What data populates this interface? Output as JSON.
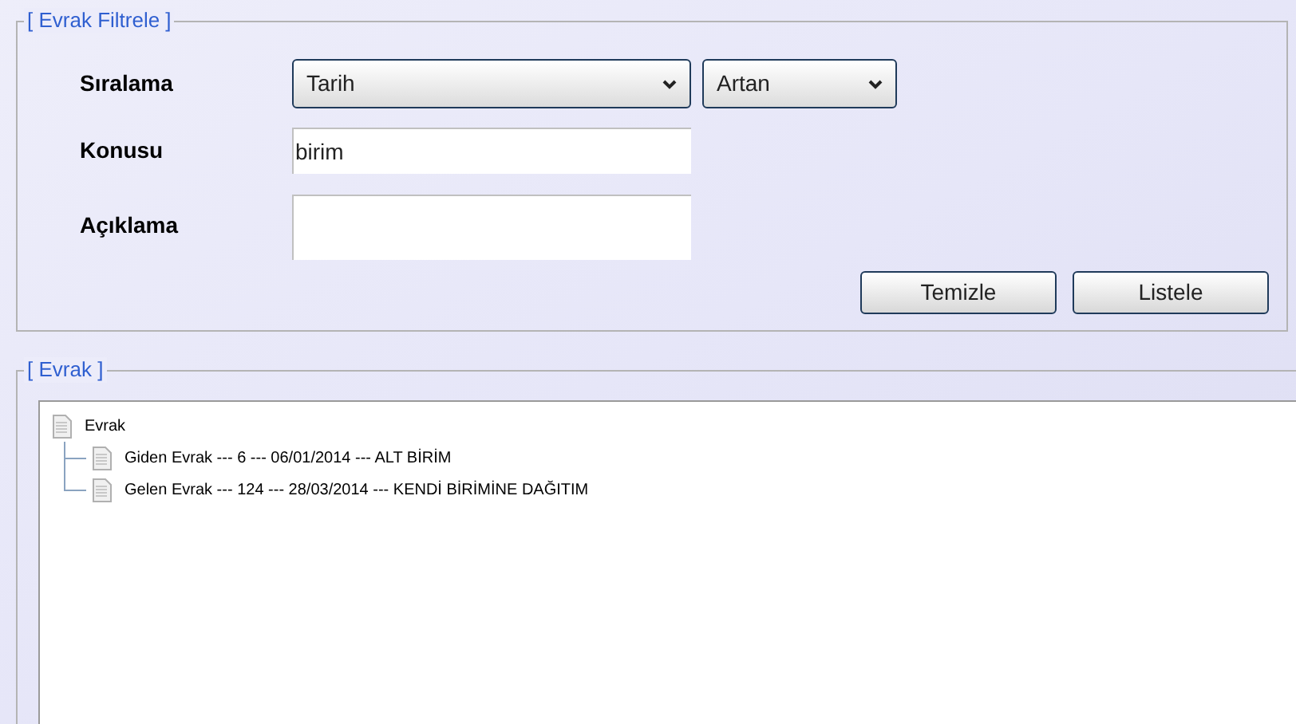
{
  "filter": {
    "legend": "[ Evrak Filtrele ]",
    "sort": {
      "label": "Sıralama",
      "field": "Tarih",
      "order": "Artan"
    },
    "subject": {
      "label": "Konusu",
      "value": "birim"
    },
    "description": {
      "label": "Açıklama"
    },
    "buttons": [
      "Temizle",
      "Listele"
    ]
  },
  "documents": {
    "legend": "[ Evrak ]",
    "tree": [
      {
        "label": "Evrak",
        "children": [
          {
            "label": "Giden Evrak --- 6 --- 06/01/2014 --- ALT BİRİM"
          },
          {
            "label": "Gelen Evrak --- 124 --- 28/03/2014 --- KENDİ BİRİMİNE DAĞITIM"
          }
        ]
      }
    ]
  }
}
